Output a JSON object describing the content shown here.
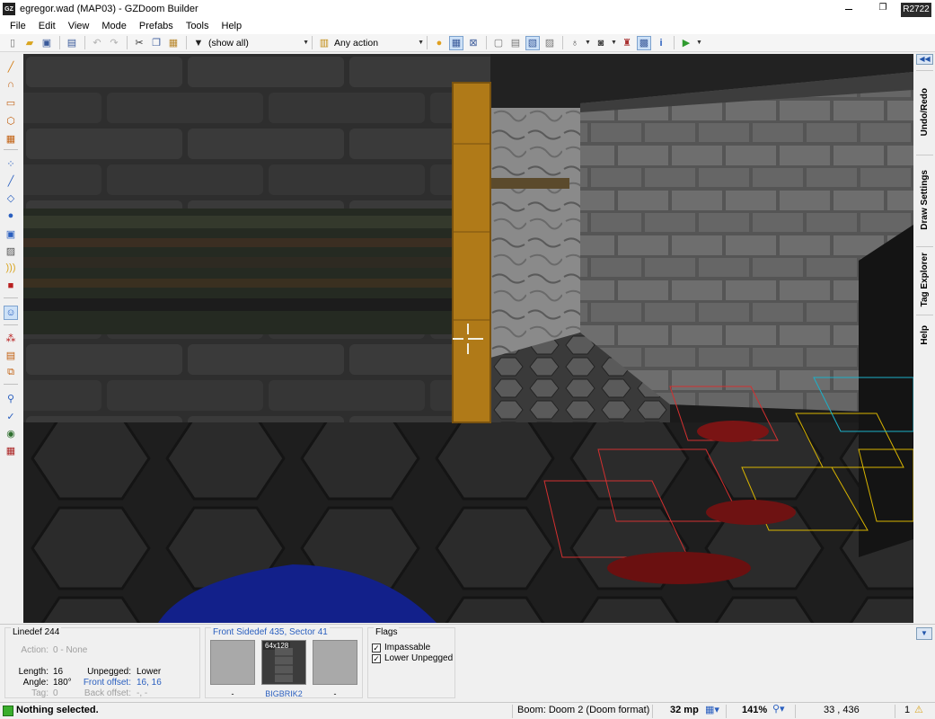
{
  "window": {
    "app_icon": "GZ",
    "title": "egregor.wad (MAP03) - GZDoom Builder",
    "minimize_icon": "minimize-icon",
    "restore_icon": "restore-icon",
    "revision": "R2722"
  },
  "menu": [
    "File",
    "Edit",
    "View",
    "Mode",
    "Prefabs",
    "Tools",
    "Help"
  ],
  "toolbar": {
    "filter_value": "(show all)",
    "action_value": "Any action"
  },
  "dock_tabs": [
    "Undo/Redo",
    "Draw Settings",
    "Tag Explorer",
    "Help"
  ],
  "linedef_panel": {
    "title": "Linedef 244",
    "action_label": "Action:",
    "action_value": "0 - None",
    "length_label": "Length:",
    "length_value": "16",
    "angle_label": "Angle:",
    "angle_value": "180°",
    "tag_label": "Tag:",
    "tag_value": "0",
    "unpegged_label": "Unpegged:",
    "unpegged_value": "Lower",
    "front_offset_label": "Front offset:",
    "front_offset_value": "16, 16",
    "back_offset_label": "Back offset:",
    "back_offset_value": "-, -"
  },
  "sidedef_panel": {
    "title": "Front Sidedef 435, Sector 41",
    "upper_texture": "-",
    "middle_texture": "BIGBRIK2",
    "middle_size": "64x128",
    "lower_texture": "-"
  },
  "flags_panel": {
    "title": "Flags",
    "flags": [
      {
        "label": "Impassable",
        "checked": true
      },
      {
        "label": "Lower Unpegged",
        "checked": true
      }
    ]
  },
  "statusbar": {
    "message": "Nothing selected.",
    "config": "Boom: Doom 2 (Doom format)",
    "grid": "32 mp",
    "zoom": "141%",
    "coords": "33  ,  436",
    "warnings": "1"
  },
  "colors": {
    "accent": "#2a5fbf",
    "status_ok": "#3aae2c",
    "viewport_bg": "#1a1a1a"
  }
}
